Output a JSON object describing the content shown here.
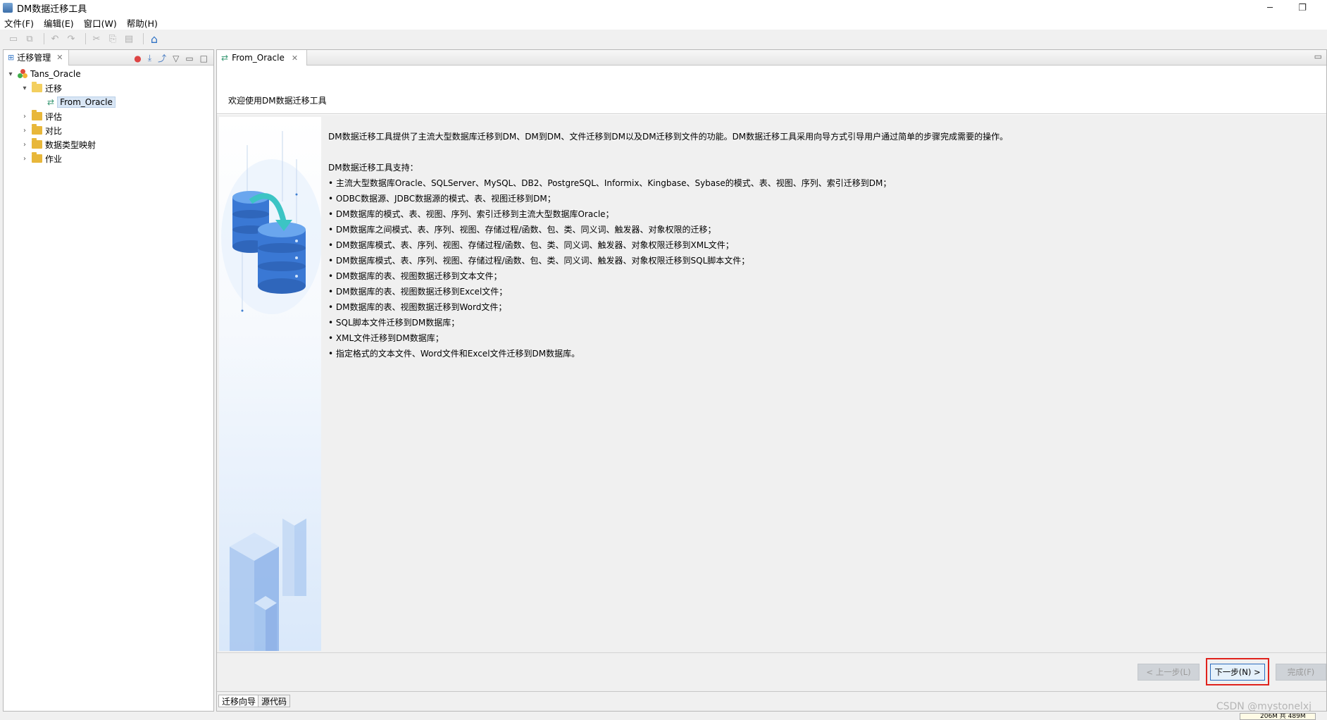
{
  "window": {
    "title": "DM数据迁移工具",
    "minimize": "─",
    "restore": "❐"
  },
  "menu": [
    "文件(F)",
    "编辑(E)",
    "窗口(W)",
    "帮助(H)"
  ],
  "toolbar": [
    "save-icon",
    "save-all-icon",
    "undo-icon",
    "redo-icon",
    "cut-icon",
    "copy-icon",
    "paste-icon",
    "home-icon"
  ],
  "left_panel": {
    "tab_label": "迁移管理",
    "tree": {
      "root": "Tans_Oracle",
      "migrate_folder": "迁移",
      "selected_item": "From_Oracle",
      "folders": [
        "评估",
        "对比",
        "数据类型映射",
        "作业"
      ]
    }
  },
  "editor": {
    "tab_label": "From_Oracle",
    "welcome_title": "欢迎使用DM数据迁移工具",
    "intro": "DM数据迁移工具提供了主流大型数据库迁移到DM、DM到DM、文件迁移到DM以及DM迁移到文件的功能。DM数据迁移工具采用向导方式引导用户通过简单的步骤完成需要的操作。",
    "support_title": "DM数据迁移工具支持：",
    "features": [
      "• 主流大型数据库Oracle、SQLServer、MySQL、DB2、PostgreSQL、Informix、Kingbase、Sybase的模式、表、视图、序列、索引迁移到DM；",
      "• ODBC数据源、JDBC数据源的模式、表、视图迁移到DM；",
      "• DM数据库的模式、表、视图、序列、索引迁移到主流大型数据库Oracle；",
      "• DM数据库之间模式、表、序列、视图、存储过程/函数、包、类、同义词、触发器、对象权限的迁移；",
      "• DM数据库模式、表、序列、视图、存储过程/函数、包、类、同义词、触发器、对象权限迁移到XML文件；",
      "• DM数据库模式、表、序列、视图、存储过程/函数、包、类、同义词、触发器、对象权限迁移到SQL脚本文件；",
      "• DM数据库的表、视图数据迁移到文本文件；",
      "• DM数据库的表、视图数据迁移到Excel文件；",
      "• DM数据库的表、视图数据迁移到Word文件；",
      "• SQL脚本文件迁移到DM数据库；",
      "• XML文件迁移到DM数据库；",
      "• 指定格式的文本文件、Word文件和Excel文件迁移到DM数据库。"
    ],
    "buttons": {
      "prev": "< 上一步(L)",
      "next": "下一步(N) >",
      "finish": "完成(F)"
    },
    "bottom_tabs": [
      "迁移向导",
      "源代码"
    ]
  },
  "watermark": "CSDN @mystonelxj",
  "memory_status": "206M 共 489M"
}
